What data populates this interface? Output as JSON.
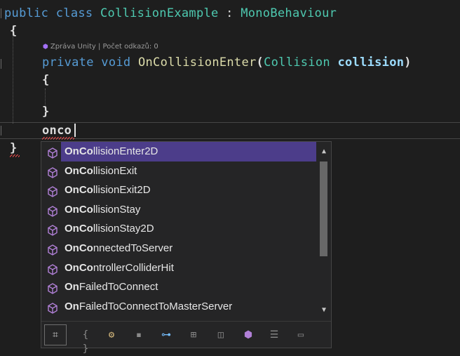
{
  "code": {
    "line1": {
      "kw1": "public",
      "kw2": "class",
      "name": "CollisionExample",
      "colon": ":",
      "base": "MonoBehaviour"
    },
    "line2": {
      "brace": "{"
    },
    "codelens": {
      "icon": "unity-icon",
      "text": "Zpráva Unity | Počet odkazů: 0"
    },
    "line3": {
      "kw1": "private",
      "kw2": "void",
      "method": "OnCollisionEnter",
      "open": "(",
      "ptype": "Collision",
      "pname": "collision",
      "close": ")"
    },
    "line4": {
      "brace": "{"
    },
    "line5": {
      "brace": "}"
    },
    "line6": {
      "typed": "onco"
    },
    "line7": {
      "brace": "}"
    }
  },
  "completion": {
    "items": [
      {
        "match": "OnCo",
        "rest": "llisionEnter2D",
        "selected": true
      },
      {
        "match": "OnCo",
        "rest": "llisionExit"
      },
      {
        "match": "OnCo",
        "rest": "llisionExit2D"
      },
      {
        "match": "OnCo",
        "rest": "llisionStay"
      },
      {
        "match": "OnCo",
        "rest": "llisionStay2D"
      },
      {
        "match": "OnCo",
        "rest": "nnectedToServer"
      },
      {
        "match": "OnCo",
        "rest": "ntrollerColliderHit"
      },
      {
        "match": "On",
        "rest": "FailedToConnect"
      },
      {
        "match": "On",
        "rest": "FailedToConnectToMasterServer"
      }
    ],
    "filters": [
      {
        "icon": "expand-filter-icon",
        "glyph": "⌗",
        "color": "#c8c8c8"
      },
      {
        "icon": "namespace-icon",
        "glyph": "{ }",
        "color": "#8a8a8a"
      },
      {
        "icon": "class-icon",
        "glyph": "⚙",
        "color": "#d7ba7d"
      },
      {
        "icon": "struct-icon",
        "glyph": "▪",
        "color": "#8a8a8a"
      },
      {
        "icon": "interface-icon",
        "glyph": "⊶",
        "color": "#75beff"
      },
      {
        "icon": "enum-icon",
        "glyph": "⊞",
        "color": "#8a8a8a"
      },
      {
        "icon": "delegate-icon",
        "glyph": "◫",
        "color": "#8a8a8a"
      },
      {
        "icon": "method-icon",
        "glyph": "⬢",
        "color": "#b180d7"
      },
      {
        "icon": "field-icon",
        "glyph": "☰",
        "color": "#8a8a8a"
      },
      {
        "icon": "snippet-icon",
        "glyph": "▭",
        "color": "#8a8a8a"
      }
    ]
  },
  "colors": {
    "keyword": "#569cd6",
    "type": "#4ec9b0",
    "method": "#dcdcaa",
    "param": "#9cdcfe",
    "selection": "#4c3d8a",
    "cube": "#b180d7"
  }
}
